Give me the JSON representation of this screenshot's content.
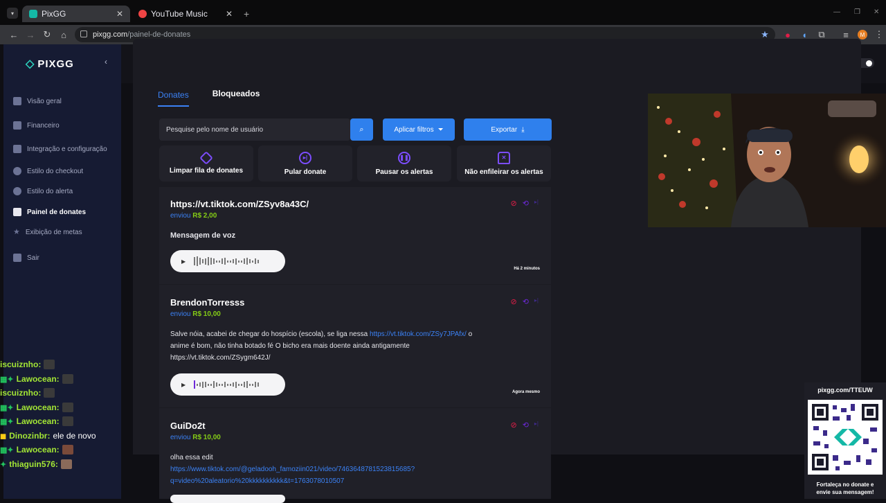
{
  "browser": {
    "tabs": [
      {
        "label": "PixGG",
        "active": true
      },
      {
        "label": "YouTube Music",
        "active": false
      }
    ],
    "new_tab": "+",
    "url_host": "pixgg.com",
    "url_path": "/painel-de-donates",
    "profile_initial": "M"
  },
  "sidebar": {
    "logo": "PIXGG",
    "items": [
      {
        "label": "Visão geral",
        "icon": "home-icon"
      },
      {
        "label": "Financeiro",
        "icon": "wallet-icon"
      },
      {
        "label": "Integração e configuração",
        "icon": "plug-icon"
      },
      {
        "label": "Estilo do checkout",
        "icon": "palette-icon"
      },
      {
        "label": "Estilo do alerta",
        "icon": "palette-icon"
      },
      {
        "label": "Painel de donates",
        "icon": "pin-icon",
        "active": true
      },
      {
        "label": "Exibição de metas",
        "icon": "star-icon"
      },
      {
        "label": "Sair",
        "icon": "logout-icon"
      }
    ]
  },
  "main": {
    "tabs": [
      "Donates",
      "Bloqueados"
    ],
    "search_placeholder": "Pesquise pelo nome de usuário",
    "filter_label": "Aplicar filtros",
    "export_label": "Exportar",
    "actions": [
      "Limpar fila de donates",
      "Pular donate",
      "Pausar os alertas",
      "Não enfileirar os alertas"
    ],
    "donates": [
      {
        "name": "https://vt.tiktok.com/ZSyv8a43C/",
        "sent": "enviou",
        "amount": "R$ 2,00",
        "message": "Mensagem de voz",
        "time": "Há 2 minutos"
      },
      {
        "name": "BrendonTorresss",
        "sent": "enviou",
        "amount": "R$ 10,00",
        "message_part1": "Salve nóia, acabei de chegar do hospício (escola), se liga nessa",
        "message_link": "https://vt.tiktok.com/ZSy7JPAfx/",
        "message_part2": "o",
        "message_line2": "anime é bom, não tinha botado fé O bicho era mais doente ainda antigamente",
        "message_line3": "https://vt.tiktok.com/ZSygm642J/",
        "time": "Agora mesmo"
      },
      {
        "name": "GuiDo2t",
        "sent": "enviou",
        "amount": "R$ 10,00",
        "message": "olha essa edit",
        "message_link_line1": "https://www.tiktok.com/@geladooh_famoziin021/video/7463648781523815685?",
        "message_link_line2": "q=video%20aleatorio%20kkkkkkkkkk&t=1763078010507"
      }
    ]
  },
  "qr": {
    "title": "pixgg.com/TTEUW",
    "caption_line1": "Fortaleça no donate e",
    "caption_line2": "envie sua mensagem!"
  },
  "chat": [
    {
      "user": "iscuiznho:",
      "badge": ""
    },
    {
      "user": "Lawocean:",
      "badge": "▦✦"
    },
    {
      "user": "iscuiznho:",
      "badge": ""
    },
    {
      "user": "Lawocean:",
      "badge": "▦✦"
    },
    {
      "user": "Lawocean:",
      "badge": "▦✦"
    },
    {
      "user": "Dinozinbr:",
      "badge": "◼",
      "text": "ele de novo"
    },
    {
      "user": "Lawocean:",
      "badge": "▦✦"
    },
    {
      "user": "thiaguin576:",
      "badge": "✦"
    }
  ],
  "colors": {
    "accent": "#2f80ed",
    "link": "#3b82f6",
    "amount": "#84cc16",
    "sidebar": "#161b33"
  }
}
